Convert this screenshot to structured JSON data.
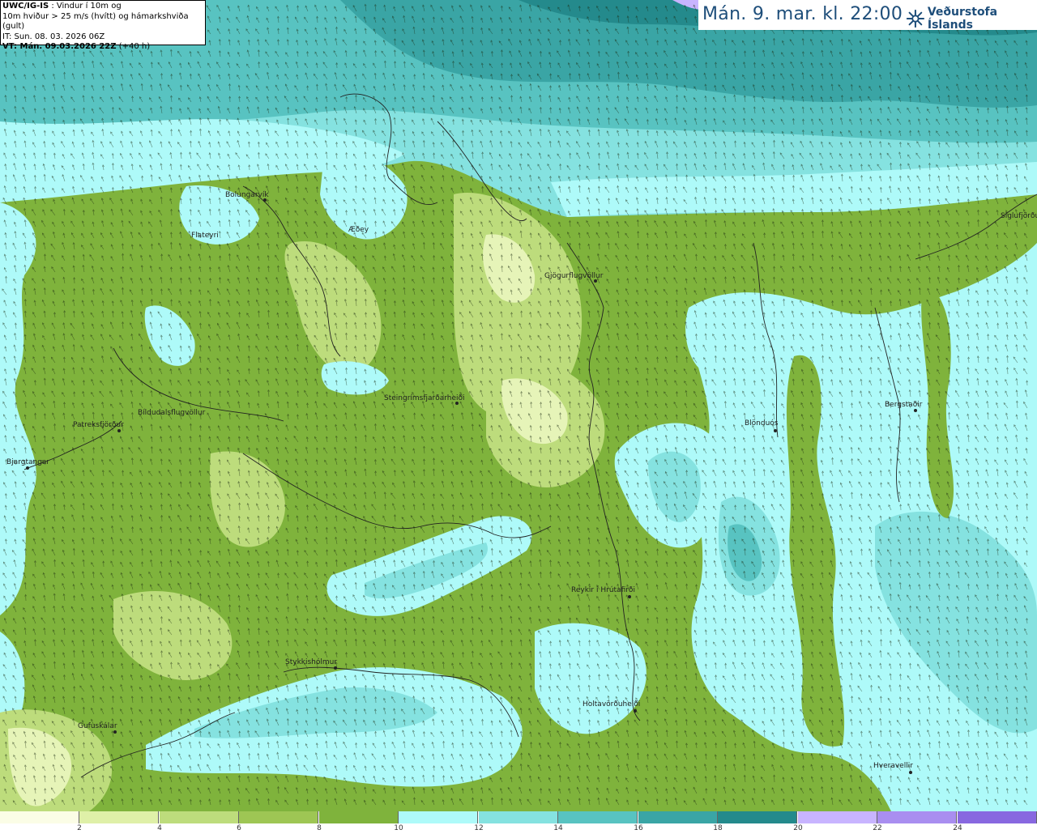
{
  "info_box": {
    "product": "UWC/IG-IS",
    "line1_suffix": " : Vindur í 10m og",
    "line2": "10m hviður > 25 m/s (hvítt) og hámarkshviða (gult)",
    "line3": "IT: Sun. 08. 03. 2026 06Z",
    "vt_label": "VT: Mán. 09.03.2026 22Z",
    "vt_suffix": " (+40 h)"
  },
  "title": "Mán. 9. mar. kl. 22:00",
  "brand": {
    "name": "Veðurstofa Íslands",
    "icon": "vedurstofa-logo-icon"
  },
  "places": [
    {
      "name": "Bolungarvík"
    },
    {
      "name": "Flateyri"
    },
    {
      "name": "Æðey"
    },
    {
      "name": "Gjögurflugvöllur"
    },
    {
      "name": "Steingrímsfjarðarheiði"
    },
    {
      "name": "Bíldudalsflugvöllur"
    },
    {
      "name": "Patreksfjörður"
    },
    {
      "name": "Bjargtangar"
    },
    {
      "name": "Blönduós"
    },
    {
      "name": "Bergstaðir"
    },
    {
      "name": "Siglufjörður"
    },
    {
      "name": "Reykir í Hrútafirði"
    },
    {
      "name": "Stykkishólmur"
    },
    {
      "name": "Holtavörðuheiði"
    },
    {
      "name": "Gufuskálar"
    },
    {
      "name": "Hveravellir"
    }
  ],
  "legend": {
    "ticks": [
      "2",
      "4",
      "6",
      "8",
      "10",
      "12",
      "14",
      "16",
      "18",
      "20",
      "22",
      "24"
    ],
    "colors": [
      "#fbfde6",
      "#dff0a8",
      "#bddc7c",
      "#9ec654",
      "#7fb33c",
      "#aefaf9",
      "#85e2e0",
      "#58c3c1",
      "#3aa5a5",
      "#248a8c",
      "#c8b4ff",
      "#a98ef0",
      "#8868e0",
      "#6a48cc",
      "#4b2aa8",
      "#ff9aa0"
    ]
  },
  "colors": {
    "land_green": "#7fb33c",
    "light_green": "#bddc7c",
    "pale_green": "#e6f4b8",
    "cyan_light": "#aefaf9",
    "cyan_mid": "#85e2e0",
    "teal": "#58c3c1",
    "teal_dark": "#3aa5a5",
    "ocean_dark": "#248a8c",
    "title_blue": "#1e4e7a"
  }
}
